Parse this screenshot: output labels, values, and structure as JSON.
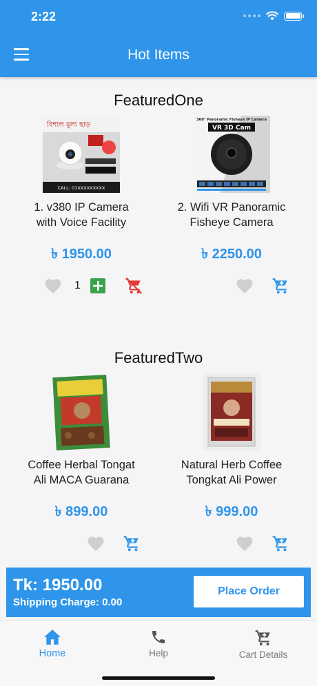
{
  "status_bar": {
    "time": "2:22"
  },
  "app_bar": {
    "title": "Hot Items"
  },
  "sections": [
    {
      "title": "FeaturedOne",
      "products": [
        {
          "name_line1": "1. v380 IP Camera",
          "name_line2": "with Voice Facility",
          "price": "৳ 1950.00",
          "quantity": "1",
          "in_cart": true,
          "image_banner": "বিশাল মূল্য ছাড়",
          "image_caption": "CALL: 01XXXXXXXXX"
        },
        {
          "name_line1": "2. Wifi VR Panoramic",
          "name_line2": "Fisheye Camera",
          "price": "৳ 2250.00",
          "in_cart": false,
          "image_header": "360° Panoramic Fisheye IP Camera",
          "image_title": "VR 3D Cam"
        }
      ]
    },
    {
      "title": "FeaturedTwo",
      "products": [
        {
          "name_line1": "Coffee Herbal Tongat",
          "name_line2": "Ali MACA Guarana",
          "price": "৳ 899.00",
          "in_cart": false
        },
        {
          "name_line1": "Natural Herb Coffee",
          "name_line2": "Tongkat Ali Power",
          "price": "৳ 999.00",
          "in_cart": false
        }
      ]
    }
  ],
  "cart": {
    "total": "Tk: 1950.00",
    "shipping": "Shipping Charge: 0.00",
    "place_order_label": "Place Order"
  },
  "bottom_nav": [
    {
      "label": "Home",
      "icon": "home-icon",
      "active": true
    },
    {
      "label": "Help",
      "icon": "phone-icon",
      "active": false
    },
    {
      "label": "Cart Details",
      "icon": "cart-icon",
      "active": false
    }
  ],
  "colors": {
    "primary": "#2e95ea",
    "add_green": "#3aa34a",
    "remove_red": "#e53935",
    "heart_grey": "#cfcfcf"
  }
}
